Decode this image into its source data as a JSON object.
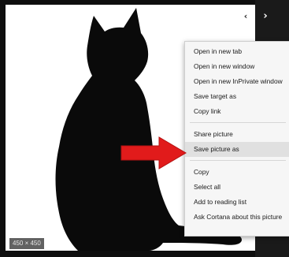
{
  "image": {
    "size_label": "450 × 450"
  },
  "navigation": {
    "prev_glyph": "‹",
    "next_glyph": "›"
  },
  "context_menu": {
    "groups": [
      {
        "items": [
          {
            "label": "Open in new tab"
          },
          {
            "label": "Open in new window"
          },
          {
            "label": "Open in new InPrivate window"
          },
          {
            "label": "Save target as"
          },
          {
            "label": "Copy link"
          }
        ]
      },
      {
        "items": [
          {
            "label": "Share picture"
          },
          {
            "label": "Save picture as",
            "highlighted": true
          }
        ]
      },
      {
        "items": [
          {
            "label": "Copy"
          },
          {
            "label": "Select all"
          },
          {
            "label": "Add to reading list"
          },
          {
            "label": "Ask Cortana about this picture"
          }
        ]
      }
    ]
  },
  "colors": {
    "arrow": "#e11b1b",
    "silhouette": "#0a0a0a",
    "menu_background": "#f6f6f6",
    "menu_highlight": "#e0e0e0"
  },
  "icons": {
    "prev": "chevron-left-icon",
    "next": "chevron-right-icon",
    "pointer": "red-arrow-icon"
  }
}
